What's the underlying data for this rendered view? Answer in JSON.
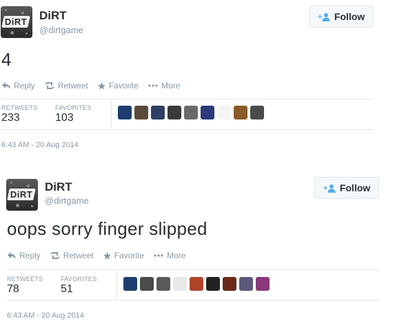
{
  "tweets": [
    {
      "author_name": "DiRT",
      "author_handle": "@dirtgame",
      "avatar_logo_text": "DiRT",
      "follow_label": "Follow",
      "text": "4",
      "actions": {
        "reply": "Reply",
        "retweet": "Retweet",
        "favorite": "Favorite",
        "more": "More"
      },
      "stats": {
        "retweets_label": "RETWEETS",
        "retweets": "233",
        "favorites_label": "FAVORITES",
        "favorites": "103"
      },
      "faces": [
        "#1c3d6e",
        "#5a4a3a",
        "#2e3e66",
        "#3a3a3a",
        "#6a6a6a",
        "#2a3a7a",
        "#f4f4f4",
        "#8a5a2a",
        "#4a4a4a"
      ],
      "timestamp": "6:43 AM - 20 Aug 2014"
    },
    {
      "author_name": "DiRT",
      "author_handle": "@dirtgame",
      "avatar_logo_text": "DiRT",
      "follow_label": "Follow",
      "text": "oops sorry finger slipped",
      "actions": {
        "reply": "Reply",
        "retweet": "Retweet",
        "favorite": "Favorite",
        "more": "More"
      },
      "stats": {
        "retweets_label": "RETWEETS",
        "retweets": "78",
        "favorites_label": "FAVORITES",
        "favorites": "51"
      },
      "faces": [
        "#1c3d6e",
        "#4a4a4a",
        "#5a5a5a",
        "#e8e8e8",
        "#b0442a",
        "#222222",
        "#6a2a1a",
        "#5a5a7a",
        "#8a3a7a"
      ],
      "timestamp": "6:43 AM - 20 Aug 2014"
    }
  ],
  "colors": {
    "accent": "#55acee",
    "muted": "#8899a6",
    "text": "#292f33",
    "border": "#e1e8ed"
  },
  "icons": [
    "reply-icon",
    "retweet-icon",
    "favorite-icon",
    "more-icon",
    "follow-person-icon"
  ]
}
